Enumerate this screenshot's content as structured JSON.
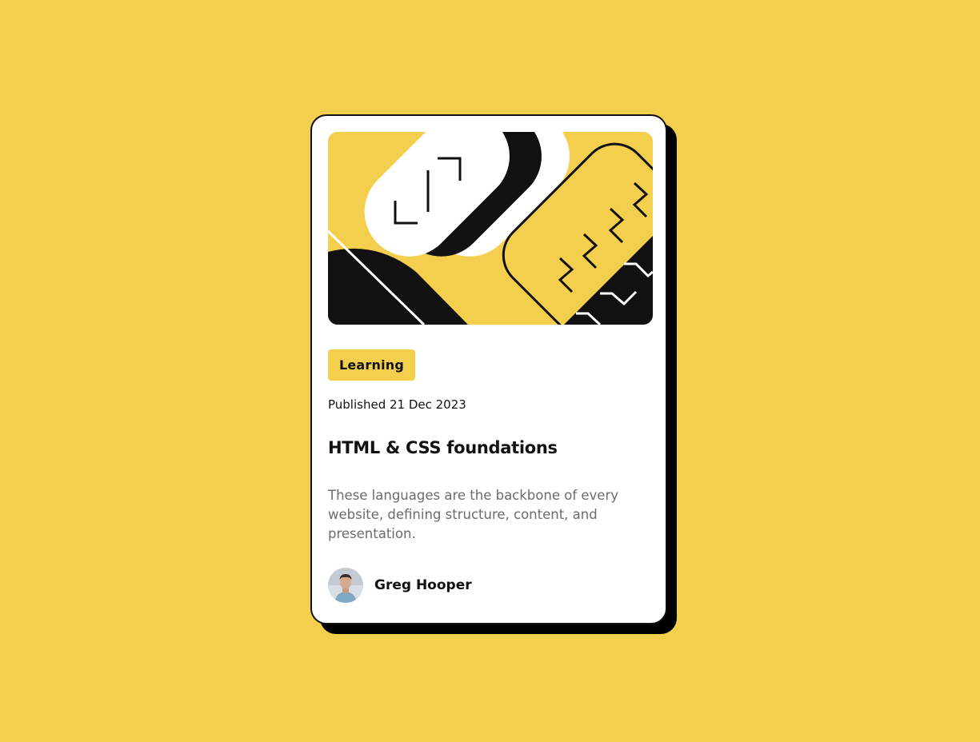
{
  "card": {
    "image_alt": "Illustration",
    "tag": "Learning",
    "published": "Published 21 Dec 2023",
    "title": "HTML & CSS foundations",
    "description": "These languages are the backbone of every website, defining structure, content, and presentation.",
    "author": {
      "name": "Greg Hooper"
    }
  },
  "colors": {
    "background": "#F4CF4E",
    "card": "#FFFFFF",
    "shadow": "#000000",
    "text": "#111111",
    "muted_text": "#6B6B6B",
    "accent": "#F4CF4E"
  }
}
